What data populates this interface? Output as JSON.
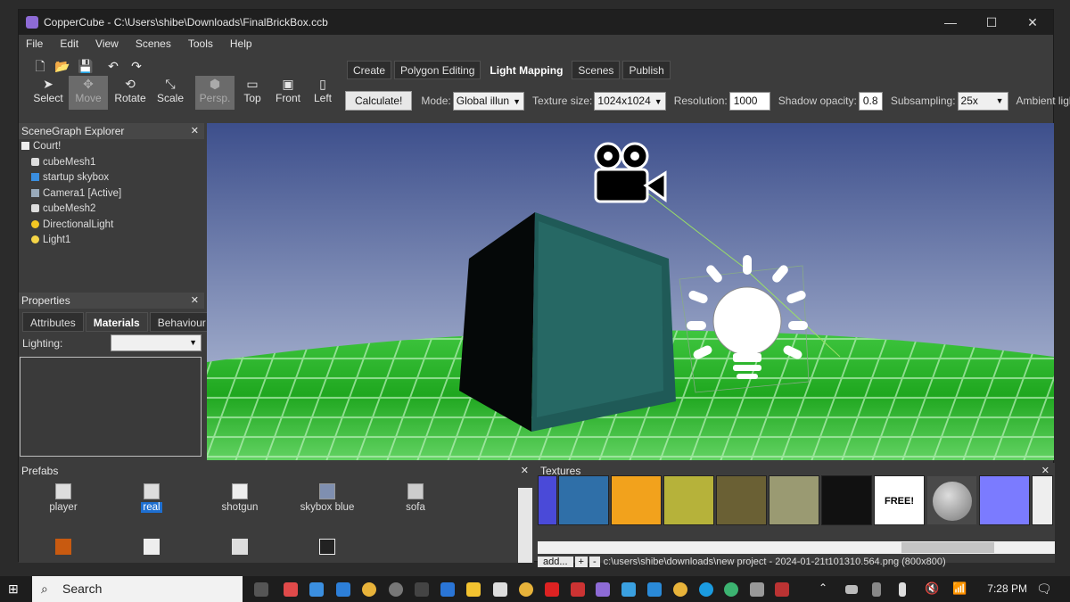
{
  "window": {
    "title": "CopperCube - C:\\Users\\shibe\\Downloads\\FinalBrickBox.ccb",
    "minimize": "—",
    "maximize": "☐",
    "close": "✕"
  },
  "menu": [
    "File",
    "Edit",
    "View",
    "Scenes",
    "Tools",
    "Help"
  ],
  "tools": [
    {
      "label": "Select",
      "icon": "cursor-icon"
    },
    {
      "label": "Move",
      "icon": "move-icon",
      "active": true
    },
    {
      "label": "Rotate",
      "icon": "rotate-icon"
    },
    {
      "label": "Scale",
      "icon": "scale-icon"
    },
    {
      "label": "Persp.",
      "icon": "cube-icon",
      "active": true
    },
    {
      "label": "Top",
      "icon": "view-top-icon"
    },
    {
      "label": "Front",
      "icon": "view-front-icon"
    },
    {
      "label": "Left",
      "icon": "view-left-icon"
    }
  ],
  "ribbon_tabs": [
    "Create",
    "Polygon Editing",
    "Light Mapping",
    "Scenes",
    "Publish"
  ],
  "ribbon_selected": "Light Mapping",
  "lightmap": {
    "calculate": "Calculate!",
    "mode_label": "Mode:",
    "mode_value": "Global illun",
    "texsize_label": "Texture size:",
    "texsize_value": "1024x1024",
    "resolution_label": "Resolution:",
    "resolution_value": "1000",
    "shadow_label": "Shadow opacity:",
    "shadow_value": "0.8",
    "subsampling_label": "Subsampling:",
    "subsampling_value": "25x",
    "ambient_label": "Ambient light:",
    "ambient_checked": "✓"
  },
  "scenegraph": {
    "title": "SceneGraph Explorer",
    "items": [
      "Court!",
      "cubeMesh1",
      "startup skybox",
      "Camera1 [Active]",
      "cubeMesh2",
      "DirectionalLight",
      "Light1"
    ]
  },
  "properties": {
    "title": "Properties",
    "tabs": [
      "Attributes",
      "Materials",
      "Behaviour"
    ],
    "selected_tab": "Materials",
    "lighting_label": "Lighting:"
  },
  "prefabs": {
    "title": "Prefabs",
    "items": [
      "player",
      "real",
      "shotgun",
      "skybox blue",
      "sofa"
    ]
  },
  "textures": {
    "title": "Textures",
    "add": "add...",
    "plus": "+",
    "minus": "-",
    "path": "c:\\users\\shibe\\downloads\\new project - 2024-01-21t101310.564.png (800x800)",
    "free_label": "FREE!"
  },
  "taskbar": {
    "search": "Search",
    "time": "7:28 PM"
  },
  "colors": {
    "accent": "#8e6bd6",
    "selected": "#1e6fd1",
    "grass": "#2fbf2f"
  }
}
